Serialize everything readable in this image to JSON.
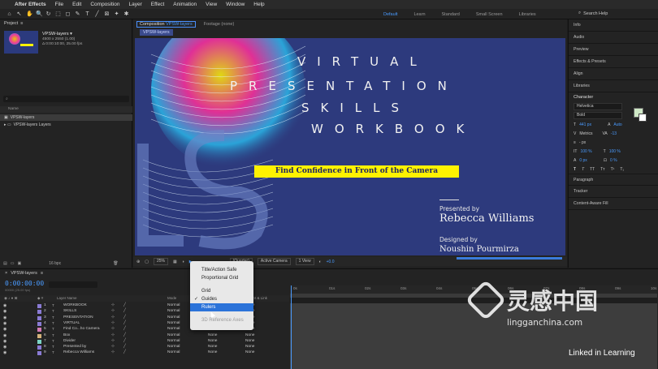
{
  "menubar": {
    "app": "After Effects",
    "items": [
      "File",
      "Edit",
      "Composition",
      "Layer",
      "Effect",
      "Animation",
      "View",
      "Window",
      "Help"
    ]
  },
  "toolbar": {
    "tools": [
      "⌂",
      "↖",
      "✋",
      "🔍",
      "↻",
      "⬚",
      "◻",
      "✎",
      "T",
      "╱",
      "⊠",
      "✦",
      "✱"
    ]
  },
  "workspaces": [
    "Default",
    "Learn",
    "Standard",
    "Small Screen",
    "Libraries"
  ],
  "search_help": "Search Help",
  "project": {
    "tab": "Project",
    "item_name": "VPSW-layers ▾",
    "item_size": "4500 x 2550 (1.00)",
    "item_duration": "Δ 0:00:10:00, 25.00 fps",
    "search_placeholder": "⌕",
    "list_header": "Name",
    "rows": [
      "VPSW-layers",
      "VPSW-layers Layers"
    ],
    "bpc": "16 bpc"
  },
  "composition": {
    "tab": "Composition",
    "comp_name": "VPSW-layers",
    "footage_tab": "Footage (none)",
    "subtab": "VPSW-layers",
    "artwork": {
      "line1": "VIRTUAL",
      "line2": "PRESENTATION",
      "line3": "SKILLS",
      "line4": "WORKBOOK",
      "headline": "Find Confidence in Front of the Camera",
      "presented_by": "Presented by",
      "presenter": "Rebecca Williams",
      "designed_by": "Designed by",
      "designer": "Noushin Pourmirza"
    },
    "footer": {
      "zoom": "25%",
      "resolution": "(Quarter)",
      "camera": "Active Camera",
      "views": "1 View",
      "exposure": "+0.0"
    }
  },
  "right_panels": {
    "items": [
      "Info",
      "Audio",
      "Preview",
      "Effects & Presets",
      "Align",
      "Libraries"
    ],
    "character": {
      "title": "Character",
      "font": "Helvetica",
      "style": "Bold",
      "size": "441 px",
      "leading": "Auto",
      "kerning": "Metrics",
      "tracking": "-13",
      "stroke_unit": "- px",
      "vscale": "100 %",
      "hscale": "100 %",
      "baseline": "0 px",
      "tsume": "0 %"
    },
    "lower": [
      "Paragraph",
      "Tracker",
      "Content-Aware Fill"
    ]
  },
  "timeline": {
    "tab": "VPSW-layers",
    "timecode": "0:00:00:00",
    "fps": "00000 (25.00 fps)",
    "header": {
      "layer_name": "Layer Name",
      "mode": "Mode",
      "parent": "Parent & Link"
    },
    "layers": [
      {
        "num": "1",
        "name": "WORKBOOK",
        "mode": "Normal",
        "color": "#8a7bd4"
      },
      {
        "num": "2",
        "name": "SKILLS",
        "mode": "Normal",
        "color": "#8a7bd4"
      },
      {
        "num": "3",
        "name": "PRESENTATION",
        "mode": "Normal",
        "color": "#8a7bd4"
      },
      {
        "num": "4",
        "name": "VIRTUAL",
        "mode": "Normal",
        "color": "#8a7bd4"
      },
      {
        "num": "5",
        "name": "Find Co...ho Camera",
        "mode": "Normal",
        "color": "#d47bb3"
      },
      {
        "num": "6",
        "name": "Box",
        "mode": "Normal",
        "color": "#d4b37b"
      },
      {
        "num": "7",
        "name": "Divider",
        "mode": "Normal",
        "color": "#7bd4c4"
      },
      {
        "num": "8",
        "name": "Presented by",
        "mode": "Normal",
        "color": "#8a7bd4"
      },
      {
        "num": "9",
        "name": "Rebecca Williams",
        "mode": "Normal",
        "color": "#8a7bd4"
      }
    ],
    "mode2": "None",
    "parent": "None",
    "ruler_ticks": [
      "0s",
      "01s",
      "02s",
      "03s",
      "04s",
      "05s",
      "06s",
      "07s",
      "08s",
      "09s",
      "10s"
    ]
  },
  "view_menu": {
    "items": [
      {
        "label": "Title/Action Safe",
        "checked": false,
        "selected": false,
        "disabled": false
      },
      {
        "label": "Proportional Grid",
        "checked": false,
        "selected": false,
        "disabled": false
      },
      {
        "label": "Grid",
        "checked": false,
        "selected": false,
        "disabled": false
      },
      {
        "label": "Guides",
        "checked": true,
        "selected": false,
        "disabled": false
      },
      {
        "label": "Rulers",
        "checked": false,
        "selected": true,
        "disabled": false
      },
      {
        "label": "3D Reference Axes",
        "checked": false,
        "selected": false,
        "disabled": true
      }
    ],
    "check_mark": "✓"
  },
  "watermark": {
    "cn": "灵感中国",
    "url": "lingganchina.com",
    "linkedin": "Linked in Learning"
  }
}
